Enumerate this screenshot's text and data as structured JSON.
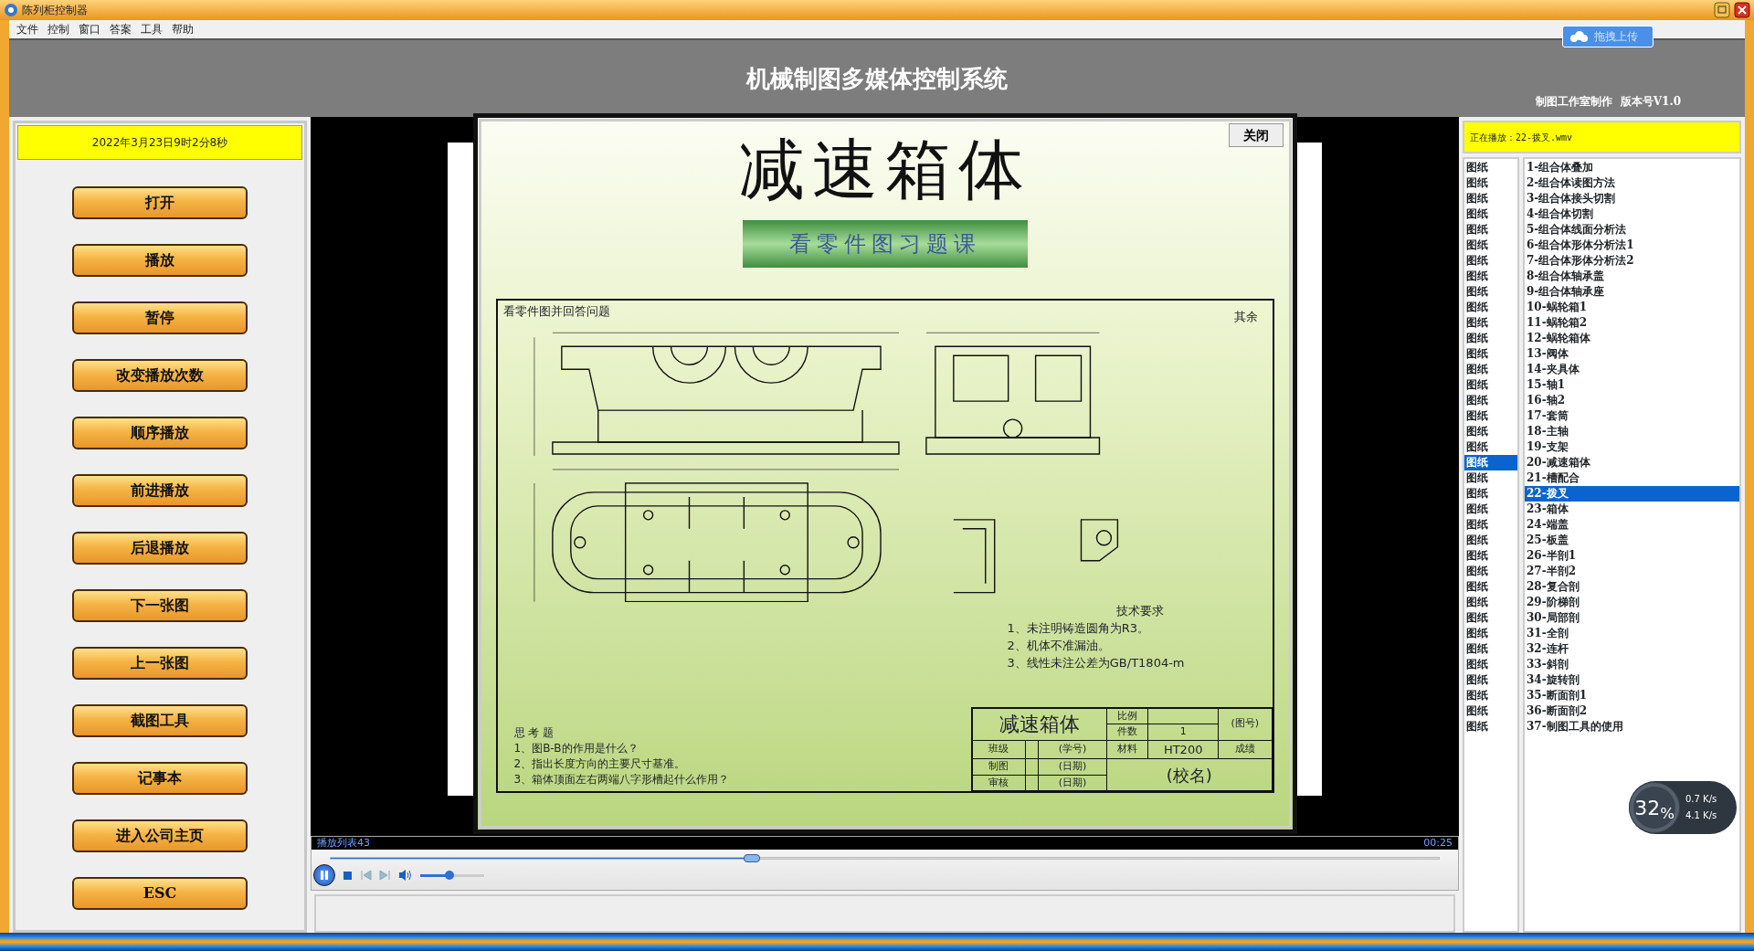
{
  "window": {
    "title": "陈列柜控制器"
  },
  "menu": [
    "文件",
    "控制",
    "窗口",
    "答案",
    "工具",
    "帮助"
  ],
  "upload_button": "拖拽上传",
  "header": {
    "title": "机械制图多媒体控制系统",
    "credit": "制图工作室制作  版本号V1.0"
  },
  "left_panel": {
    "datetime": "2022年3月23日9时2分8秒",
    "buttons": [
      "打开",
      "播放",
      "暂停",
      "改变播放次数",
      "顺序播放",
      "前进播放",
      "后退播放",
      "下一张图",
      "上一张图",
      "截图工具",
      "记事本",
      "进入公司主页",
      "ESC"
    ]
  },
  "dialog": {
    "close_button": "关闭",
    "title": "减速箱体",
    "subtitle": "看零件图习题课",
    "sheet": {
      "heading": "看零件图并回答问题",
      "roughness_note": "其余",
      "requirements_title": "技术要求",
      "requirements": [
        "1、未注明铸造圆角为R3。",
        "2、机体不准漏油。",
        "3、线性未注公差为GB/T1804-m"
      ],
      "questions_title": "思 考 题",
      "questions": [
        "1、图B-B的作用是什么？",
        "2、指出长度方向的主要尺寸基准。",
        "3、箱体顶面左右两端八字形槽起什么作用？"
      ],
      "title_block": {
        "part_name": "减速箱体",
        "scale_label": "比例",
        "quantity_label": "件数",
        "quantity": "1",
        "drawing_no": "(图号)",
        "class_label": "班级",
        "student_no": "(学号)",
        "material_label": "材料",
        "material": "HT200",
        "grade_label": "成绩",
        "drawn_label": "制图",
        "date_1": "(日期)",
        "checked_label": "审核",
        "date_2": "(日期)",
        "school": "(校名)"
      }
    }
  },
  "player": {
    "playlist": "播放列表43",
    "time": "00:25",
    "level": 0.38,
    "volume": {
      "level": 0.45
    },
    "playing": true
  },
  "now_playing": "正在播放：22-拨叉.wmv",
  "type_list": [
    {
      "label": "图纸",
      "selected": false
    },
    {
      "label": "图纸",
      "selected": false
    },
    {
      "label": "图纸",
      "selected": false
    },
    {
      "label": "图纸",
      "selected": false
    },
    {
      "label": "图纸",
      "selected": false
    },
    {
      "label": "图纸",
      "selected": false
    },
    {
      "label": "图纸",
      "selected": false
    },
    {
      "label": "图纸",
      "selected": false
    },
    {
      "label": "图纸",
      "selected": false
    },
    {
      "label": "图纸",
      "selected": false
    },
    {
      "label": "图纸",
      "selected": false
    },
    {
      "label": "图纸",
      "selected": false
    },
    {
      "label": "图纸",
      "selected": false
    },
    {
      "label": "图纸",
      "selected": false
    },
    {
      "label": "图纸",
      "selected": false
    },
    {
      "label": "图纸",
      "selected": false
    },
    {
      "label": "图纸",
      "selected": false
    },
    {
      "label": "图纸",
      "selected": false
    },
    {
      "label": "图纸",
      "selected": false
    },
    {
      "label": "图纸",
      "selected": true
    },
    {
      "label": "图纸",
      "selected": false
    },
    {
      "label": "图纸",
      "selected": false
    },
    {
      "label": "图纸",
      "selected": false
    },
    {
      "label": "图纸",
      "selected": false
    },
    {
      "label": "图纸",
      "selected": false
    },
    {
      "label": "图纸",
      "selected": false
    },
    {
      "label": "图纸",
      "selected": false
    },
    {
      "label": "图纸",
      "selected": false
    },
    {
      "label": "图纸",
      "selected": false
    },
    {
      "label": "图纸",
      "selected": false
    },
    {
      "label": "图纸",
      "selected": false
    },
    {
      "label": "图纸",
      "selected": false
    },
    {
      "label": "图纸",
      "selected": false
    },
    {
      "label": "图纸",
      "selected": false
    },
    {
      "label": "图纸",
      "selected": false
    },
    {
      "label": "图纸",
      "selected": false
    },
    {
      "label": "图纸",
      "selected": false
    }
  ],
  "name_list": [
    {
      "label": "1-组合体叠加",
      "selected": false
    },
    {
      "label": "2-组合体读图方法",
      "selected": false
    },
    {
      "label": "3-组合体接头切割",
      "selected": false
    },
    {
      "label": "4-组合体切割",
      "selected": false
    },
    {
      "label": "5-组合体线面分析法",
      "selected": false
    },
    {
      "label": "6-组合体形体分析法1",
      "selected": false
    },
    {
      "label": "7-组合体形体分析法2",
      "selected": false
    },
    {
      "label": "8-组合体轴承盖",
      "selected": false
    },
    {
      "label": "9-组合体轴承座",
      "selected": false
    },
    {
      "label": "10-蜗轮箱1",
      "selected": false
    },
    {
      "label": "11-蜗轮箱2",
      "selected": false
    },
    {
      "label": "12-蜗轮箱体",
      "selected": false
    },
    {
      "label": "13-阀体",
      "selected": false
    },
    {
      "label": "14-夹具体",
      "selected": false
    },
    {
      "label": "15-轴1",
      "selected": false
    },
    {
      "label": "16-轴2",
      "selected": false
    },
    {
      "label": "17-套筒",
      "selected": false
    },
    {
      "label": "18-主轴",
      "selected": false
    },
    {
      "label": "19-支架",
      "selected": false
    },
    {
      "label": "20-减速箱体",
      "selected": false
    },
    {
      "label": "21-槽配合",
      "selected": false
    },
    {
      "label": "22-拨叉",
      "selected": true
    },
    {
      "label": "23-箱体",
      "selected": false
    },
    {
      "label": "24-端盖",
      "selected": false
    },
    {
      "label": "25-板盖",
      "selected": false
    },
    {
      "label": "26-半剖1",
      "selected": false
    },
    {
      "label": "27-半剖2",
      "selected": false
    },
    {
      "label": "28-复合剖",
      "selected": false
    },
    {
      "label": "29-阶梯剖",
      "selected": false
    },
    {
      "label": "30-局部剖",
      "selected": false
    },
    {
      "label": "31-全剖",
      "selected": false
    },
    {
      "label": "32-连杆",
      "selected": false
    },
    {
      "label": "33-斜剖",
      "selected": false
    },
    {
      "label": "34-旋转剖",
      "selected": false
    },
    {
      "label": "35-断面剖1",
      "selected": false
    },
    {
      "label": "36-断面剖2",
      "selected": false
    },
    {
      "label": "37-制图工具的使用",
      "selected": false
    }
  ],
  "network": {
    "percent": "32$_{%}$",
    "upload": "0.7 K/s",
    "download": "4.1 K/s"
  }
}
